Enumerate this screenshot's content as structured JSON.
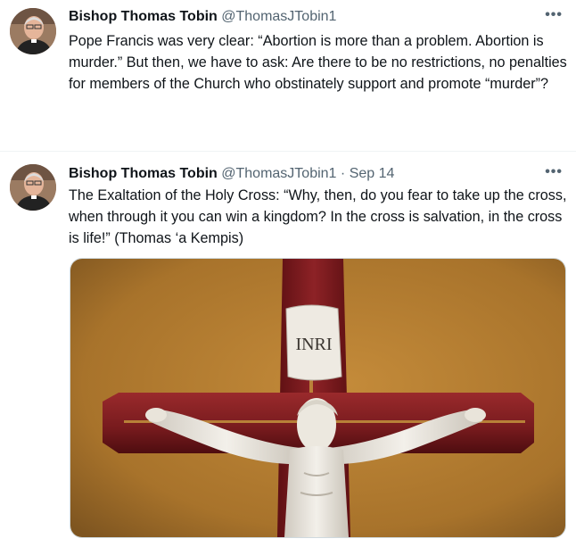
{
  "tweets": [
    {
      "name": "Bishop Thomas Tobin",
      "handle": "@ThomasJTobin1",
      "date": "",
      "text": "Pope Francis was very clear: “Abortion is more than a problem. Abortion is murder.” But then, we have to ask: Are there to be no restrictions, no penalties for members of the Church who obstinately support and promote “murder”?",
      "more_icon": "more-horizontal-icon"
    },
    {
      "name": "Bishop Thomas Tobin",
      "handle": "@ThomasJTobin1",
      "separator": "·",
      "date": "Sep 14",
      "text": "The Exaltation of the Holy Cross: “Why, then, do you fear to take up the cross, when through it you can win a kingdom? In the cross is salvation, in the cross is life!” (Thomas ‘a Kempis)",
      "media_caption": "INRI",
      "more_icon": "more-horizontal-icon"
    }
  ],
  "colors": {
    "text": "#0f1419",
    "secondary": "#536471",
    "divider": "#eff3f4",
    "wall": "#b07a2c",
    "cross": "#7e1a1e",
    "corpus": "#eeeae2"
  }
}
